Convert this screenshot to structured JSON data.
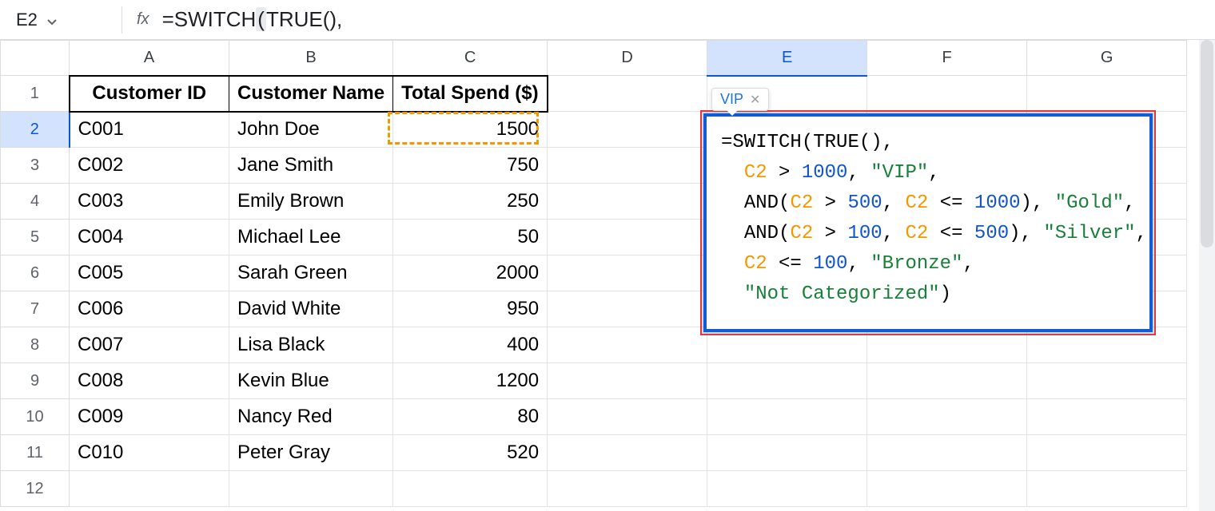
{
  "name_box": "E2",
  "formula_bar_prefix": "=SWITCH",
  "formula_bar_paren": "(",
  "formula_bar_rest": "TRUE(),",
  "columns": [
    "A",
    "B",
    "C",
    "D",
    "E",
    "F",
    "G"
  ],
  "col_widths": {
    "row": 86,
    "A": 200,
    "B": 198,
    "C": 193,
    "D": 200,
    "E": 200,
    "F": 200,
    "G": 200
  },
  "selected_col": "E",
  "selected_row": 2,
  "headers": {
    "A": "Customer ID",
    "B": "Customer Name",
    "C": "Total Spend ($)"
  },
  "rows": [
    {
      "n": 1
    },
    {
      "n": 2,
      "A": "C001",
      "B": "John Doe",
      "C": "1500"
    },
    {
      "n": 3,
      "A": "C002",
      "B": "Jane Smith",
      "C": "750"
    },
    {
      "n": 4,
      "A": "C003",
      "B": "Emily Brown",
      "C": "250"
    },
    {
      "n": 5,
      "A": "C004",
      "B": "Michael Lee",
      "C": "50"
    },
    {
      "n": 6,
      "A": "C005",
      "B": "Sarah Green",
      "C": "2000"
    },
    {
      "n": 7,
      "A": "C006",
      "B": "David White",
      "C": "950"
    },
    {
      "n": 8,
      "A": "C007",
      "B": "Lisa Black",
      "C": "400"
    },
    {
      "n": 9,
      "A": "C008",
      "B": "Kevin Blue",
      "C": "1200"
    },
    {
      "n": 10,
      "A": "C009",
      "B": "Nancy Red",
      "C": "80"
    },
    {
      "n": 11,
      "A": "C010",
      "B": "Peter Gray",
      "C": "520"
    },
    {
      "n": 12
    }
  ],
  "tooltip_result": "VIP",
  "formula_tokens": [
    [
      {
        "t": "=",
        "c": "tok-op"
      },
      {
        "t": "SWITCH",
        "c": "tok-fn"
      },
      {
        "t": "(",
        "c": "tok-op"
      },
      {
        "t": "TRUE",
        "c": "tok-fn"
      },
      {
        "t": "()",
        "c": "tok-op"
      },
      {
        "t": ",",
        "c": "tok-op"
      }
    ],
    [
      {
        "t": "  ",
        "c": ""
      },
      {
        "t": "C2",
        "c": "tok-ref"
      },
      {
        "t": " > ",
        "c": "tok-op"
      },
      {
        "t": "1000",
        "c": "tok-num"
      },
      {
        "t": ", ",
        "c": "tok-op"
      },
      {
        "t": "\"VIP\"",
        "c": "tok-str"
      },
      {
        "t": ",",
        "c": "tok-op"
      }
    ],
    [
      {
        "t": "  ",
        "c": ""
      },
      {
        "t": "AND",
        "c": "tok-fn"
      },
      {
        "t": "(",
        "c": "tok-op"
      },
      {
        "t": "C2",
        "c": "tok-ref"
      },
      {
        "t": " > ",
        "c": "tok-op"
      },
      {
        "t": "500",
        "c": "tok-num"
      },
      {
        "t": ", ",
        "c": "tok-op"
      },
      {
        "t": "C2",
        "c": "tok-ref"
      },
      {
        "t": " <= ",
        "c": "tok-op"
      },
      {
        "t": "1000",
        "c": "tok-num"
      },
      {
        "t": ")",
        "c": "tok-op"
      },
      {
        "t": ", ",
        "c": "tok-op"
      },
      {
        "t": "\"Gold\"",
        "c": "tok-str"
      },
      {
        "t": ",",
        "c": "tok-op"
      }
    ],
    [
      {
        "t": "  ",
        "c": ""
      },
      {
        "t": "AND",
        "c": "tok-fn"
      },
      {
        "t": "(",
        "c": "tok-op"
      },
      {
        "t": "C2",
        "c": "tok-ref"
      },
      {
        "t": " > ",
        "c": "tok-op"
      },
      {
        "t": "100",
        "c": "tok-num"
      },
      {
        "t": ", ",
        "c": "tok-op"
      },
      {
        "t": "C2",
        "c": "tok-ref"
      },
      {
        "t": " <= ",
        "c": "tok-op"
      },
      {
        "t": "500",
        "c": "tok-num"
      },
      {
        "t": ")",
        "c": "tok-op"
      },
      {
        "t": ", ",
        "c": "tok-op"
      },
      {
        "t": "\"Silver\"",
        "c": "tok-str"
      },
      {
        "t": ",",
        "c": "tok-op"
      }
    ],
    [
      {
        "t": "  ",
        "c": ""
      },
      {
        "t": "C2",
        "c": "tok-ref"
      },
      {
        "t": " <= ",
        "c": "tok-op"
      },
      {
        "t": "100",
        "c": "tok-num"
      },
      {
        "t": ", ",
        "c": "tok-op"
      },
      {
        "t": "\"Bronze\"",
        "c": "tok-str"
      },
      {
        "t": ",",
        "c": "tok-op"
      }
    ],
    [
      {
        "t": "  ",
        "c": ""
      },
      {
        "t": "\"Not Categorized\"",
        "c": "tok-str"
      },
      {
        "t": ")",
        "c": "tok-op"
      }
    ]
  ],
  "ref_cell": {
    "col": "C",
    "row": 2
  }
}
